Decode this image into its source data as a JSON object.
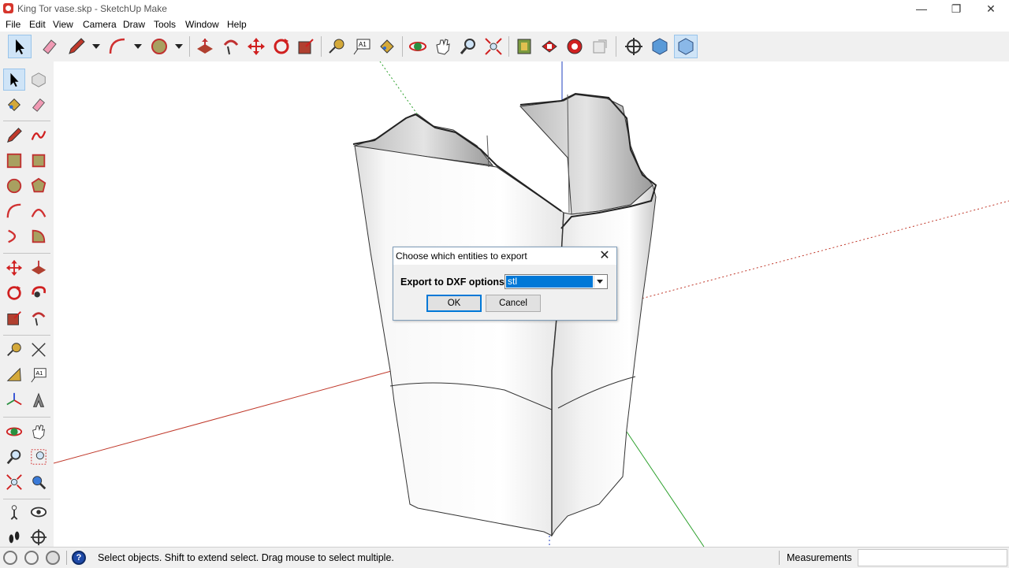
{
  "window": {
    "title": "King Tor vase.skp - SketchUp Make",
    "minimize": "—",
    "restore": "❐",
    "close": "✕"
  },
  "menu": [
    "File",
    "Edit",
    "View",
    "Camera",
    "Draw",
    "Tools",
    "Window",
    "Help"
  ],
  "toolbar_icons": [
    "select-icon",
    "eraser-icon",
    "pencil-icon",
    "arc-icon",
    "circle-icon",
    "push-pull-icon",
    "follow-me-icon",
    "move-icon",
    "rotate-icon",
    "scale-icon",
    "tape-measure-icon",
    "text-icon",
    "paint-bucket-icon",
    "orbit-icon",
    "pan-icon",
    "zoom-icon",
    "zoom-extents-icon",
    "3d-warehouse-icon",
    "extension-warehouse-icon",
    "layout-icon",
    "share-model-icon",
    "position-camera-icon",
    "component-icon",
    "solid-icon"
  ],
  "status": {
    "message": "Select objects. Shift to extend select. Drag mouse to select multiple.",
    "measurements_label": "Measurements",
    "measurements_value": ""
  },
  "dialog": {
    "title": "Choose which entities to export",
    "label": "Export to DXF options",
    "selected_option": "stl",
    "ok_label": "OK",
    "cancel_label": "Cancel"
  },
  "colors": {
    "accent": "#0078d7",
    "axis_red": "#c0392b",
    "axis_green": "#2ca02c",
    "axis_blue": "#1f3fbf"
  }
}
